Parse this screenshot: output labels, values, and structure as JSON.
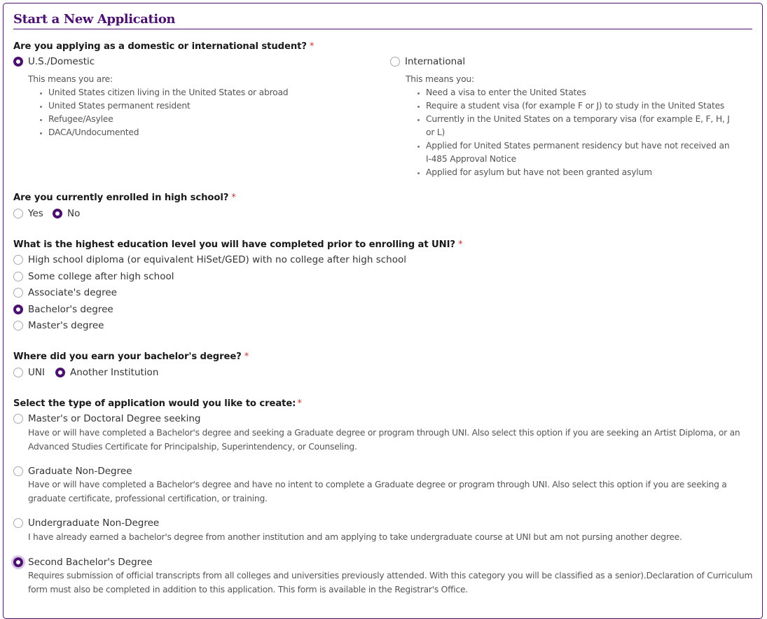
{
  "title": "Start a New Application",
  "required_marker": "*",
  "colors": {
    "accent": "#4b116f",
    "required": "#c0392b"
  },
  "q_student_type": {
    "label": "Are you applying as a domestic or international student?",
    "options": [
      {
        "label": "U.S./Domestic",
        "selected": true,
        "intro": "This means you are:",
        "bullets": [
          "United States citizen living in the United States or abroad",
          "United States permanent resident",
          "Refugee/Asylee",
          "DACA/Undocumented"
        ]
      },
      {
        "label": "International",
        "selected": false,
        "intro": "This means you:",
        "bullets": [
          "Need a visa to enter the United States",
          "Require a student visa (for example F or J) to study in the United States",
          "Currently in the United States on a temporary visa (for example E, F, H, J or L)",
          "Applied for United States permanent residency but have not received an I-485 Approval Notice",
          "Applied for asylum but have not been granted asylum"
        ]
      }
    ]
  },
  "q_high_school": {
    "label": "Are you currently enrolled in high school?",
    "options": [
      {
        "label": "Yes",
        "selected": false
      },
      {
        "label": "No",
        "selected": true
      }
    ]
  },
  "q_education": {
    "label": "What is the highest education level you will have completed prior to enrolling at UNI?",
    "options": [
      {
        "label": "High school diploma (or equivalent HiSet/GED) with no college after high school",
        "selected": false
      },
      {
        "label": "Some college after high school",
        "selected": false
      },
      {
        "label": "Associate's degree",
        "selected": false
      },
      {
        "label": "Bachelor's degree",
        "selected": true
      },
      {
        "label": "Master's degree",
        "selected": false
      }
    ]
  },
  "q_bachelor_where": {
    "label": "Where did you earn your bachelor's degree?",
    "options": [
      {
        "label": "UNI",
        "selected": false
      },
      {
        "label": "Another Institution",
        "selected": true
      }
    ]
  },
  "q_app_type": {
    "label": "Select the type of application would you like to create:",
    "options": [
      {
        "label": "Master's or Doctoral Degree seeking",
        "selected": false,
        "description": "Have or will have completed a Bachelor's degree and seeking a Graduate degree or program through UNI. Also select this option if you are seeking an Artist Diploma, or an Advanced Studies Certificate for Principalship, Superintendency, or Counseling."
      },
      {
        "label": "Graduate Non-Degree",
        "selected": false,
        "description": "Have or will have completed a Bachelor's degree and have no intent to complete a Graduate degree or program through UNI. Also select this option if you are seeking a graduate certificate, professional certification, or training."
      },
      {
        "label": "Undergraduate Non-Degree",
        "selected": false,
        "description": "I have already earned a bachelor's degree from another institution and am applying to take undergraduate course at UNI but am not pursing another degree."
      },
      {
        "label": "Second Bachelor's Degree",
        "selected": true,
        "description": "Requires submission of official transcripts from all colleges and universities previously attended. With this category you will be classified as a senior).Declaration of Curriculum form must also be completed in addition to this application. This form is available in the Registrar's Office."
      }
    ]
  }
}
